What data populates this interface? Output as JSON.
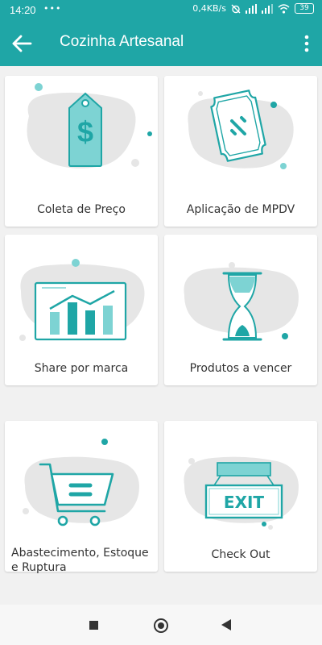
{
  "status": {
    "time": "14:20",
    "indicators": "•••",
    "speed": "0,4KB/s",
    "battery": "39"
  },
  "appbar": {
    "title": "Cozinha Artesanal"
  },
  "cards": [
    {
      "label": "Coleta de Preço",
      "icon": "price-tag-icon"
    },
    {
      "label": "Aplicação de MPDV",
      "icon": "ticket-icon"
    },
    {
      "label": "Share por marca",
      "icon": "bar-chart-icon"
    },
    {
      "label": "Produtos a vencer",
      "icon": "hourglass-icon"
    },
    {
      "label": "Abastecimento, Estoque e Ruptura",
      "icon": "shopping-cart-icon"
    },
    {
      "label": "Check Out",
      "icon": "exit-sign-icon",
      "sign_text": "EXIT"
    }
  ],
  "colors": {
    "primary": "#1fa6a6",
    "accent_light": "#7dd3d3",
    "blob": "#e6e6e6",
    "background": "#f1f1f1"
  }
}
